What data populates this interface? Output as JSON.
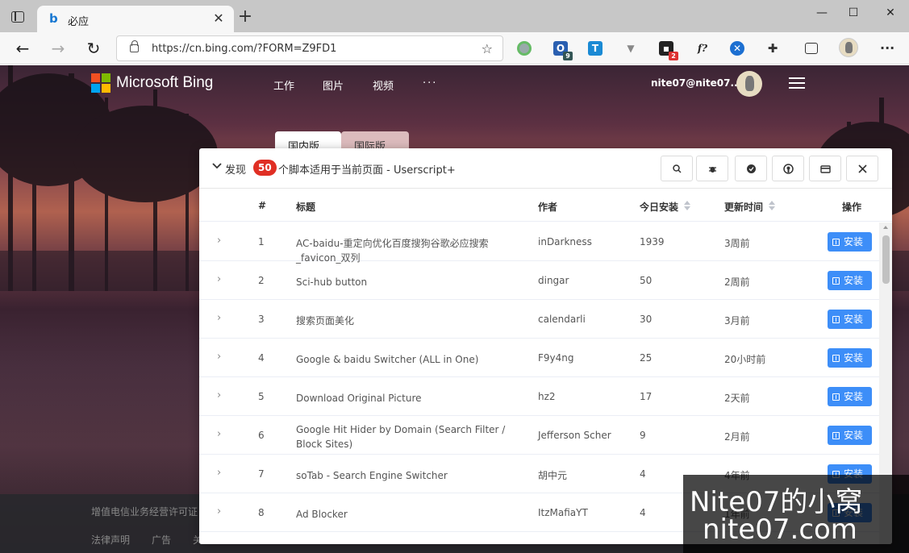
{
  "browser": {
    "tab_title": "必应",
    "url": "https://cn.bing.com/?FORM=Z9FD1",
    "extensions": [
      {
        "name": "ext-green-circle-icon",
        "badge": ""
      },
      {
        "name": "ext-blue-box-icon",
        "badge": "9"
      },
      {
        "name": "ext-t-icon",
        "badge": ""
      },
      {
        "name": "ext-v-icon",
        "badge": ""
      },
      {
        "name": "ext-dark-box-icon",
        "badge": "2"
      },
      {
        "name": "ext-function-icon",
        "badge": ""
      },
      {
        "name": "ext-blue-ball-icon",
        "badge": ""
      }
    ],
    "ext_f_label": "f?",
    "ext_t_label": "T"
  },
  "page": {
    "brand": "Microsoft Bing",
    "nav": [
      "工作",
      "图片",
      "视频",
      "···"
    ],
    "user": "nite07@nite07....",
    "region_tabs": [
      "国内版",
      "国际版"
    ],
    "footer_line": "增值电信业务经营许可证",
    "footer_links": [
      "法律声明",
      "广告",
      "关"
    ]
  },
  "dialog": {
    "title_prefix": "发现",
    "count": "50",
    "title_suffix": "个脚本适用于当前页面 - Userscript+",
    "columns": {
      "num": "#",
      "title": "标题",
      "author": "作者",
      "installs": "今日安装",
      "updated": "更新时间",
      "action": "操作"
    },
    "install_label": "安装",
    "rows": [
      {
        "num": "1",
        "title": "AC-baidu-重定向优化百度搜狗谷歌必应搜索_favicon_双列",
        "author": "inDarkness",
        "installs": "1939",
        "updated": "3周前"
      },
      {
        "num": "2",
        "title": "Sci-hub button",
        "author": "dingar",
        "installs": "50",
        "updated": "2周前"
      },
      {
        "num": "3",
        "title": "搜索页面美化",
        "author": "calendarli",
        "installs": "30",
        "updated": "3月前"
      },
      {
        "num": "4",
        "title": "Google & baidu Switcher (ALL in One)",
        "author": "F9y4ng",
        "installs": "25",
        "updated": "20小时前"
      },
      {
        "num": "5",
        "title": "Download Original Picture",
        "author": "hz2",
        "installs": "17",
        "updated": "2天前"
      },
      {
        "num": "6",
        "title": "Google Hit Hider by Domain (Search Filter / Block Sites)",
        "author": "Jefferson Scher",
        "installs": "9",
        "updated": "2月前"
      },
      {
        "num": "7",
        "title": "soTab - Search Engine Switcher",
        "author": "胡中元",
        "installs": "4",
        "updated": "4年前"
      },
      {
        "num": "8",
        "title": "Ad Blocker",
        "author": "ItzMafiaYT",
        "installs": "4",
        "updated": "1年前"
      }
    ]
  },
  "watermark": {
    "line1": "Nite07的小窝",
    "line2": "nite07.com"
  },
  "colors": {
    "accent": "#3d8ef8",
    "badge": "#e02f24"
  }
}
